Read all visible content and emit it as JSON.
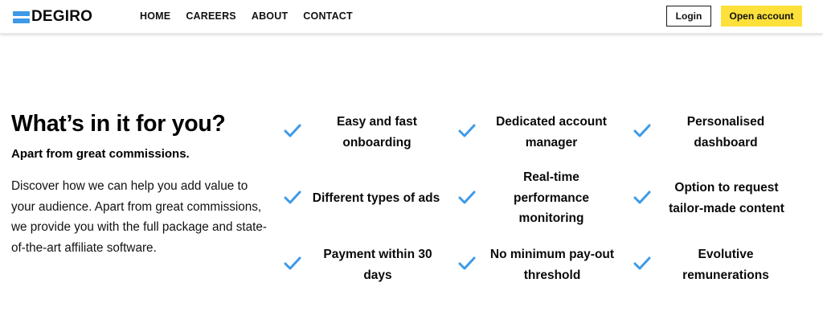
{
  "header": {
    "brand": "DEGIRO",
    "nav": [
      "HOME",
      "CAREERS",
      "ABOUT",
      "CONTACT"
    ],
    "login_label": "Login",
    "open_account_label": "Open account"
  },
  "intro": {
    "title": "What’s in it for you?",
    "subtitle": "Apart from great commissions.",
    "description": "Discover how we can help you add value to your audience. Apart from great commissions, we provide you with the full package and state-of-the-art affiliate software."
  },
  "features": [
    "Easy and fast onboarding",
    "Dedicated account manager",
    "Personalised dashboard",
    "Different types of ads",
    "Real-time performance monitoring",
    "Option to request tailor-made content",
    "Payment within 30 days",
    "No minimum pay-out threshold",
    "Evolutive remunerations"
  ],
  "colors": {
    "accent_blue": "#3d9ae8",
    "button_yellow": "#fde03a"
  }
}
